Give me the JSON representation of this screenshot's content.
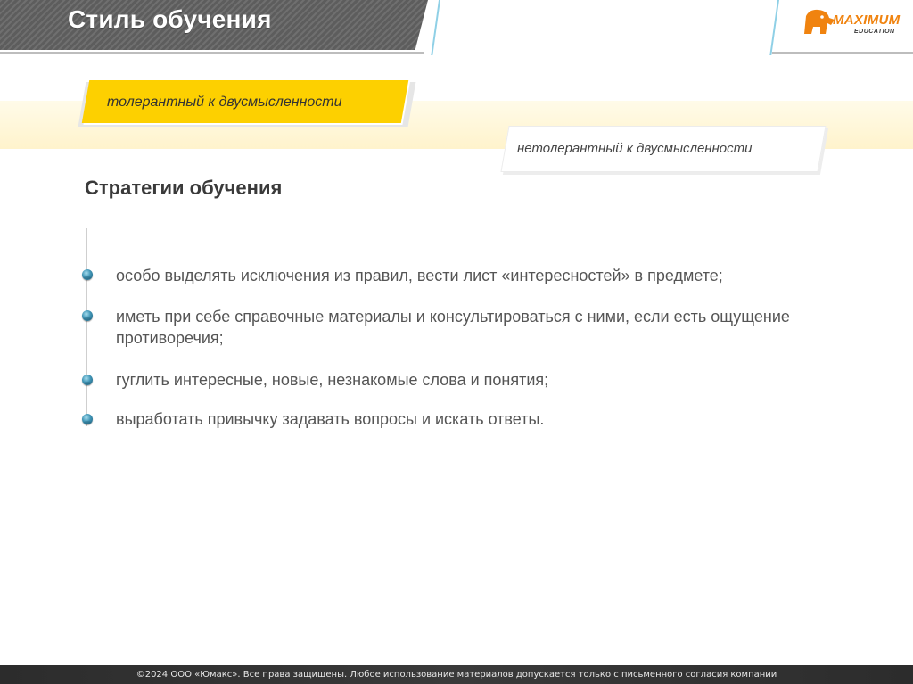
{
  "header": {
    "title": "Стиль обучения"
  },
  "logo": {
    "main": "MAXIMUM",
    "sub": "EDUCATION",
    "icon": "elephant-logo-icon",
    "color": "#f0830f"
  },
  "tags": {
    "tolerant": "толерантный к двусмысленности",
    "intolerant": "нетолерантный к двусмысленности"
  },
  "section": {
    "heading": "Стратегии обучения",
    "items": [
      "особо выделять исключения из правил, вести лист «интересностей» в предмете;",
      "иметь при себе справочные материалы и консультироваться с ними, если есть ощущение противоречия;",
      "гуглить интересные, новые, незнакомые слова и понятия;",
      "выработать привычку задавать вопросы и искать ответы."
    ]
  },
  "footer": {
    "text": "©2024 ООО «Юмакс». Все права защищены. Любое использование материалов допускается только с письменного согласия компании"
  },
  "colors": {
    "accent": "#fdd000",
    "header": "#666666",
    "text": "#555555"
  }
}
